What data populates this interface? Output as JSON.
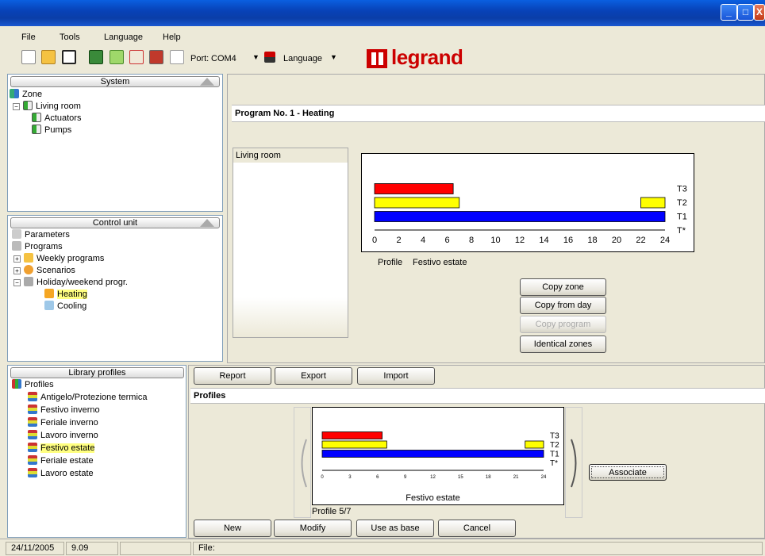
{
  "menu": [
    "File",
    "Tools",
    "Language",
    "Help"
  ],
  "toolbar": {
    "port_label": "Port:",
    "port_value": "COM4",
    "language_label": "Language",
    "logo_text": "legrand"
  },
  "system_panel": {
    "title": "System",
    "items": [
      "Zone",
      "Living room",
      "Actuators",
      "Pumps"
    ]
  },
  "control_panel": {
    "title": "Control unit",
    "items": [
      "Parameters",
      "Programs",
      "Weekly programs",
      "Scenarios",
      "Holiday/weekend progr.",
      "Heating",
      "Cooling"
    ]
  },
  "library_panel": {
    "title": "Library profiles",
    "items": [
      "Profiles",
      "Antigelo/Protezione termica",
      "Festivo inverno",
      "Feriale inverno",
      "Lavoro inverno",
      "Festivo estate",
      "Feriale estate",
      "Lavoro estate"
    ]
  },
  "program": {
    "title": "Program No. 1 - Heating",
    "zone_list": [
      "Living room"
    ],
    "profile_label": "Profile",
    "profile_name": "Festivo estate",
    "buttons": [
      "Copy zone",
      "Copy from day",
      "Copy program",
      "Identical zones"
    ]
  },
  "profiles_area": {
    "buttons_top": [
      "Report",
      "Export",
      "Import"
    ],
    "header": "Profiles",
    "chart_caption": "Festivo estate",
    "counter": "Profile 5/7",
    "associate": "Associate",
    "buttons_bottom": [
      "New",
      "Modify",
      "Use as base",
      "Cancel"
    ]
  },
  "status": {
    "date": "24/11/2005",
    "version": "9.09",
    "file_label": "File:"
  },
  "colors": {
    "T3": "#ff0000",
    "T2": "#ffff00",
    "T1": "#0000ff"
  },
  "chart_data": [
    {
      "type": "bar",
      "orientation": "horizontal-timeline",
      "categories": [
        "T3",
        "T2",
        "T1",
        "T*"
      ],
      "x_ticks": [
        0,
        2,
        4,
        6,
        8,
        10,
        12,
        14,
        16,
        18,
        20,
        22,
        24
      ],
      "xlim": [
        0,
        24
      ],
      "series": [
        {
          "level": "T3",
          "intervals": [
            [
              0,
              6.5
            ]
          ]
        },
        {
          "level": "T2",
          "intervals": [
            [
              0,
              7
            ],
            [
              22,
              24
            ]
          ]
        },
        {
          "level": "T1",
          "intervals": [
            [
              0,
              24
            ]
          ]
        },
        {
          "level": "T*",
          "intervals": []
        }
      ]
    },
    {
      "type": "bar",
      "orientation": "horizontal-timeline",
      "categories": [
        "T3",
        "T2",
        "T1",
        "T*"
      ],
      "x_ticks": [
        0,
        3,
        6,
        9,
        12,
        15,
        18,
        21,
        24
      ],
      "xlim": [
        0,
        24
      ],
      "title": "Festivo estate",
      "series": [
        {
          "level": "T3",
          "intervals": [
            [
              0,
              6.5
            ]
          ]
        },
        {
          "level": "T2",
          "intervals": [
            [
              0,
              7
            ],
            [
              22,
              24
            ]
          ]
        },
        {
          "level": "T1",
          "intervals": [
            [
              0,
              24
            ]
          ]
        },
        {
          "level": "T*",
          "intervals": []
        }
      ]
    }
  ]
}
